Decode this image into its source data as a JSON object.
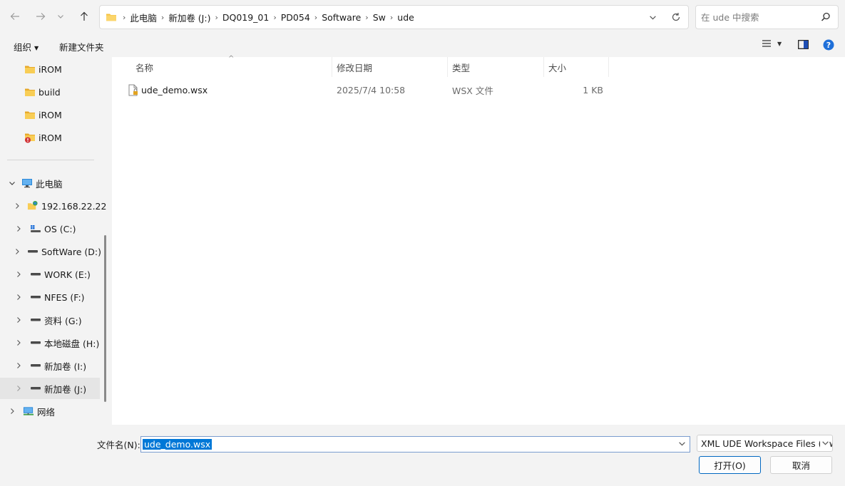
{
  "address": {
    "segments": [
      "此电脑",
      "新加卷 (J:)",
      "DQ019_01",
      "PD054",
      "Software",
      "Sw",
      "ude"
    ]
  },
  "search": {
    "placeholder": "在 ude 中搜索"
  },
  "toolbar": {
    "organize": "组织",
    "new_folder": "新建文件夹"
  },
  "nav": {
    "quick": [
      {
        "label": "iROM",
        "icon": "folder-icon"
      },
      {
        "label": "build",
        "icon": "folder-icon"
      },
      {
        "label": "iROM",
        "icon": "folder-icon"
      },
      {
        "label": "iROM",
        "icon": "folder-error-icon"
      }
    ],
    "this_pc": "此电脑",
    "drives": [
      {
        "label": "192.168.22.22",
        "icon": "network-drive-icon"
      },
      {
        "label": "OS (C:)",
        "icon": "windows-drive-icon"
      },
      {
        "label": "SoftWare (D:)",
        "icon": "drive-icon"
      },
      {
        "label": "WORK (E:)",
        "icon": "drive-icon"
      },
      {
        "label": "NFES (F:)",
        "icon": "drive-icon"
      },
      {
        "label": "资料 (G:)",
        "icon": "drive-icon"
      },
      {
        "label": "本地磁盘 (H:)",
        "icon": "drive-icon"
      },
      {
        "label": "新加卷 (I:)",
        "icon": "drive-icon"
      },
      {
        "label": "新加卷 (J:)",
        "icon": "drive-icon"
      }
    ],
    "network": "网络"
  },
  "columns": {
    "name": "名称",
    "date": "修改日期",
    "type": "类型",
    "size": "大小"
  },
  "files": [
    {
      "name": "ude_demo.wsx",
      "date": "2025/7/4 10:58",
      "type": "WSX 文件",
      "size": "1 KB"
    }
  ],
  "footer": {
    "filename_label": "文件名(N):",
    "filename_value": "ude_demo.wsx",
    "filetype_value": "XML UDE Workspace Files (*.wsx)",
    "open_label": "打开(O)",
    "cancel_label": "取消"
  },
  "colors": {
    "accent": "#0067c0",
    "folder": "#f5c242",
    "selection": "#0078d7"
  }
}
